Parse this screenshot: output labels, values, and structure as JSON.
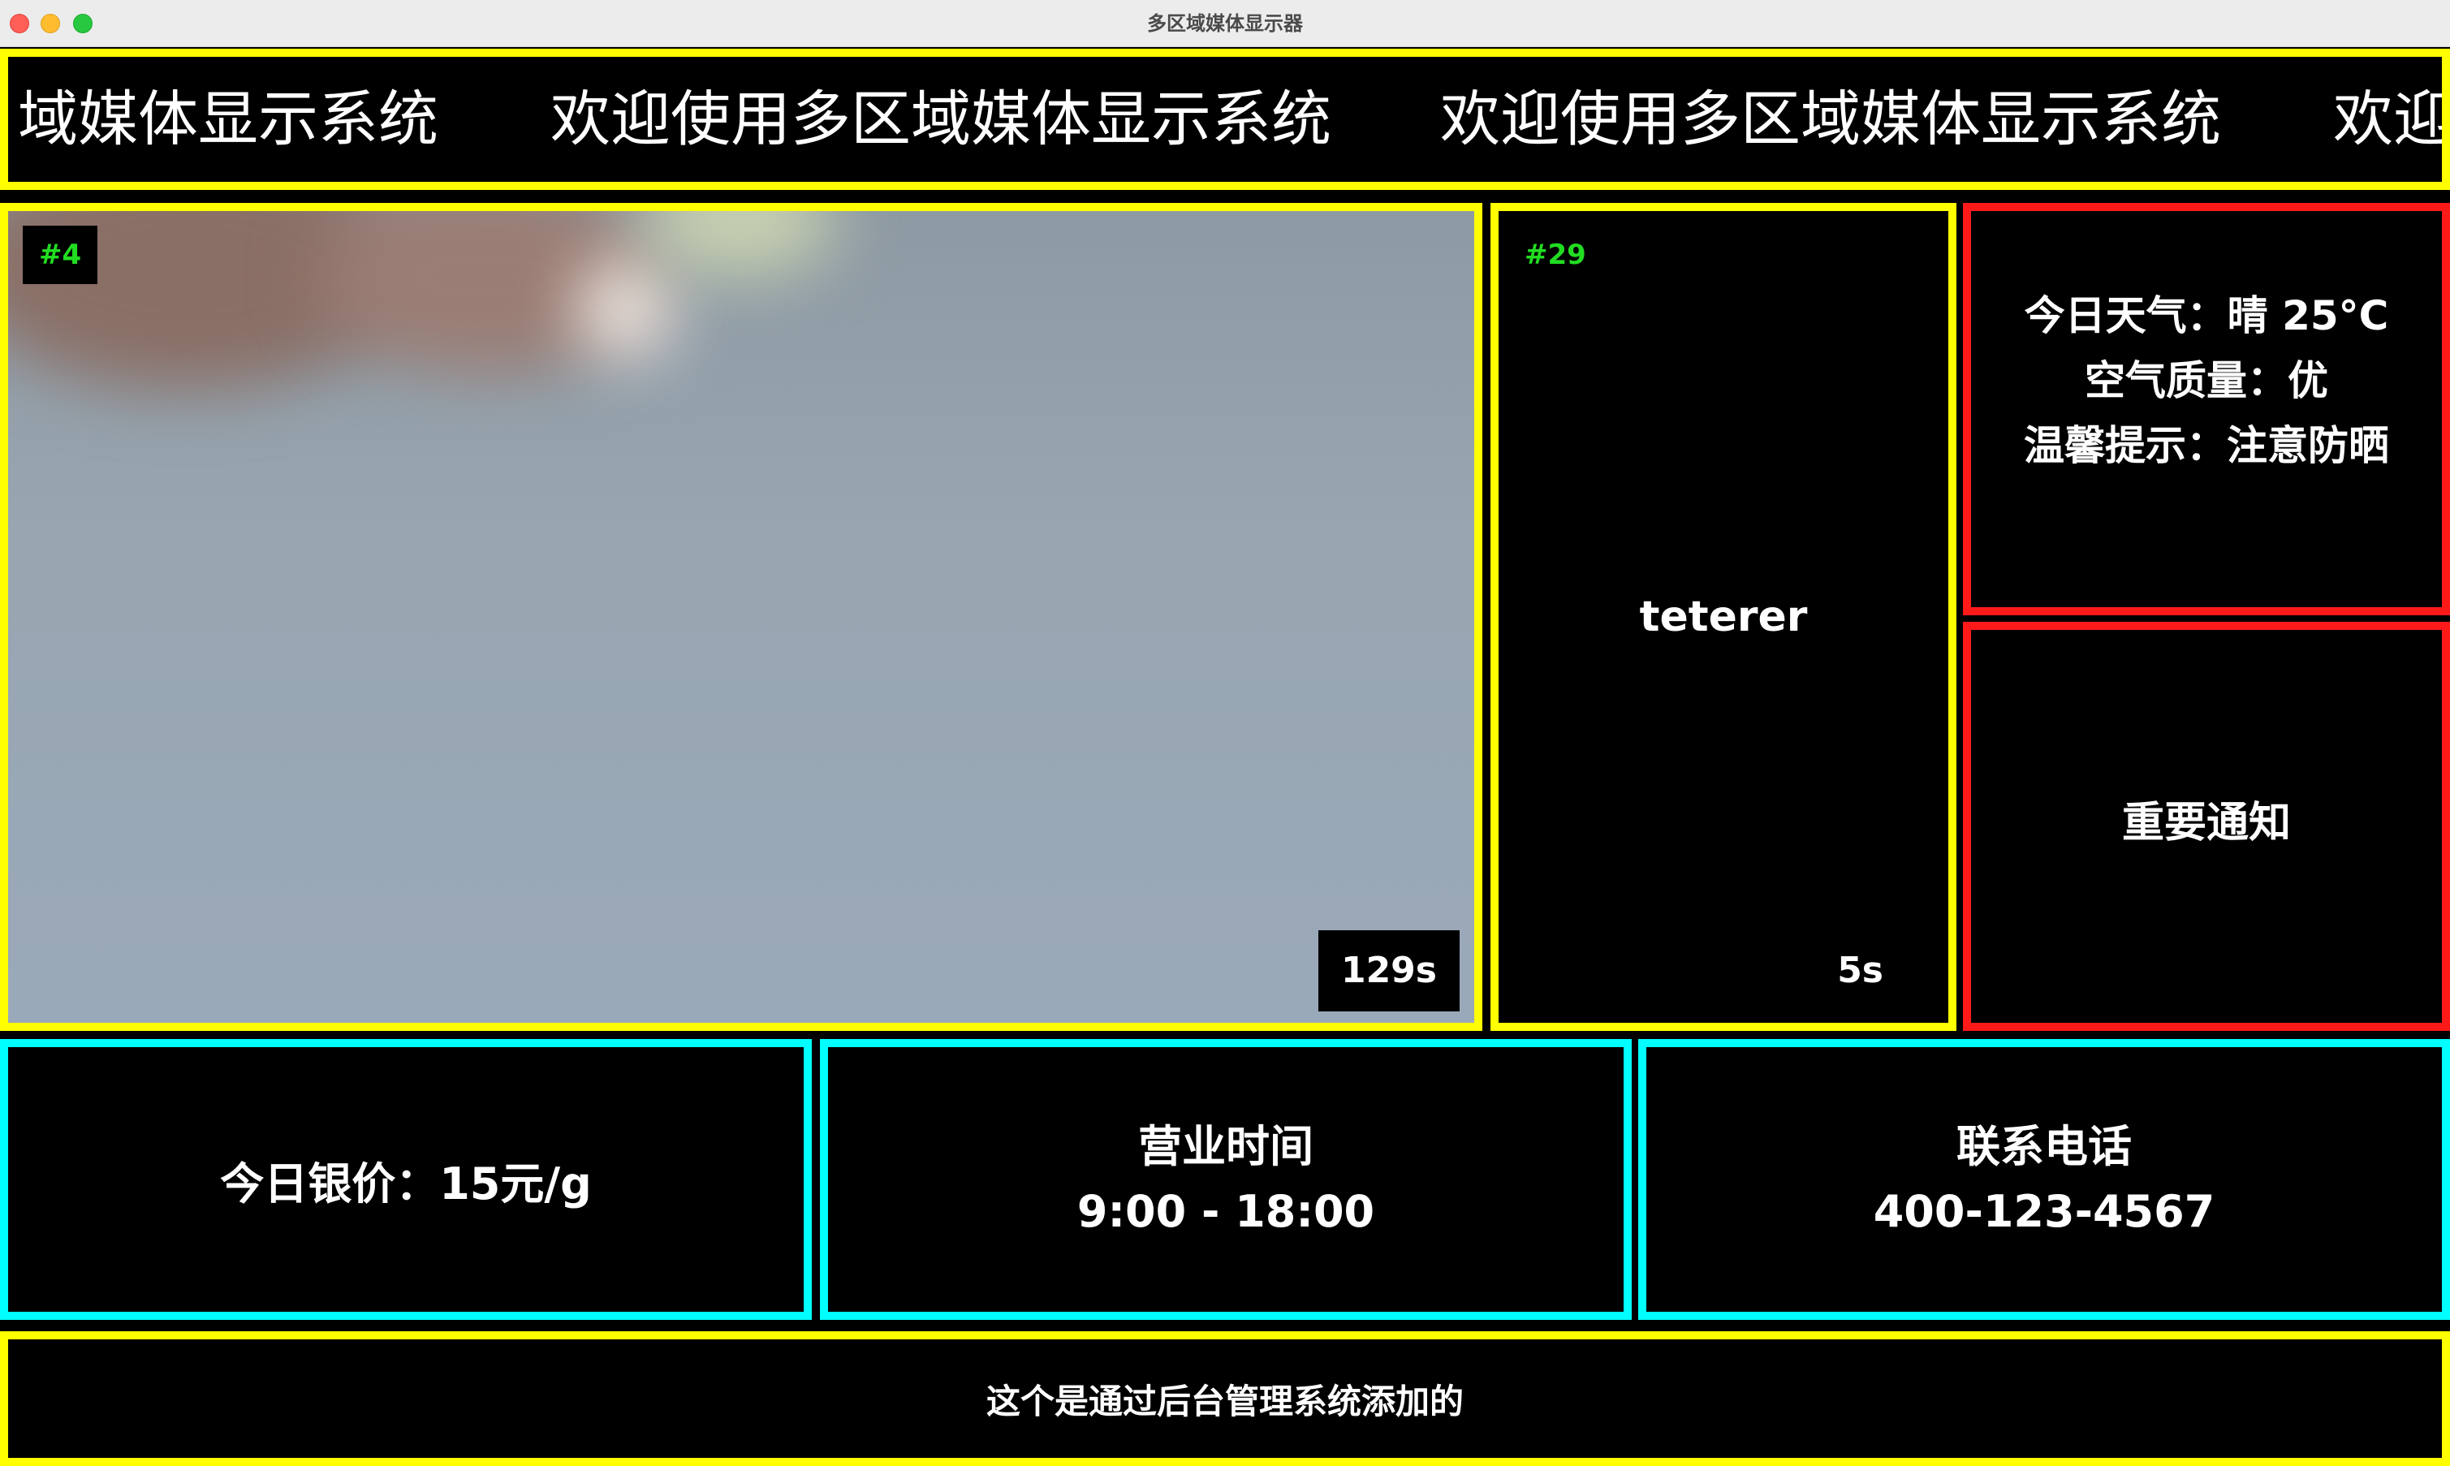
{
  "window": {
    "title": "多区域媒体显示器"
  },
  "marquee": {
    "text": "欢迎使用多区域媒体显示系统",
    "segments": [
      "域媒体显示系统",
      "欢迎使用多区域媒体显示系统",
      "欢迎使用多区域媒体显示系统",
      "欢迎"
    ]
  },
  "video_zone": {
    "tag": "#4",
    "timer": "129s"
  },
  "text_zone": {
    "tag": "#29",
    "content": "teterer",
    "timer": "5s"
  },
  "weather_zone": {
    "lines": [
      "今日天气：晴 25°C",
      "空气质量：优",
      "温馨提示：注意防晒"
    ]
  },
  "notice_zone": {
    "text": "重要通知"
  },
  "silver_zone": {
    "text": "今日银价：15元/g"
  },
  "hours_zone": {
    "title": "营业时间",
    "value": "9:00 - 18:00"
  },
  "phone_zone": {
    "title": "联系电话",
    "value": "400-123-4567"
  },
  "footer": {
    "text": "这个是通过后台管理系统添加的"
  },
  "colors": {
    "yellow_border": "#ffff00",
    "red_border": "#ff1a1a",
    "cyan_border": "#00ffff",
    "tag_green": "#22dd22"
  }
}
